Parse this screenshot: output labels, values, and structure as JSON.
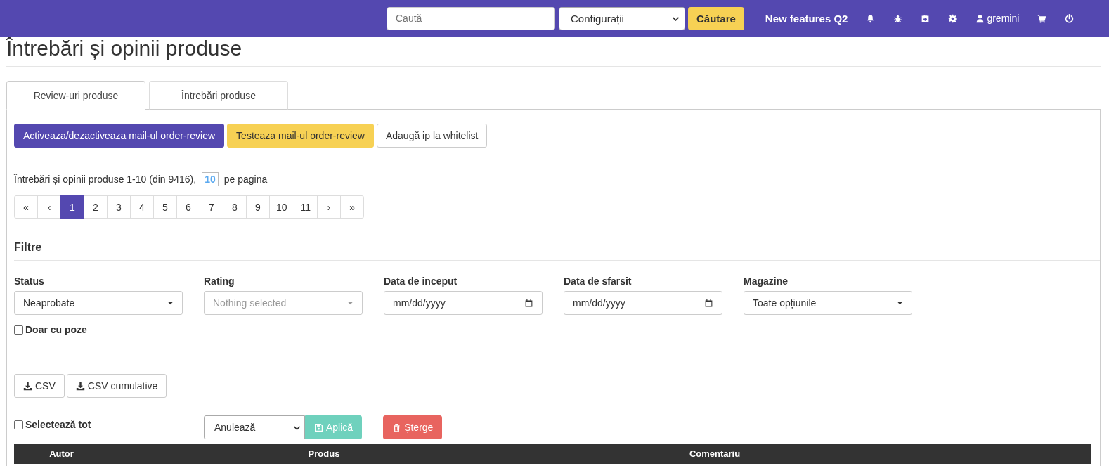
{
  "navbar": {
    "search": {
      "placeholder": "Caută"
    },
    "scope_select": {
      "value": "Configurații"
    },
    "search_button": "Căutare",
    "link": "New features Q2",
    "icons": [
      {
        "kind": "bell"
      },
      {
        "kind": "bug"
      },
      {
        "kind": "medkit"
      },
      {
        "kind": "gear"
      },
      {
        "kind": "user",
        "label": "gremini"
      },
      {
        "kind": "cart"
      },
      {
        "kind": "power"
      }
    ]
  },
  "page_title": "Întrebări și opinii produse",
  "tabs": [
    {
      "label": "Review-uri produse",
      "selected": true
    },
    {
      "label": "Întrebări produse",
      "selected": false
    }
  ],
  "action_buttons": [
    {
      "label": "Activeaza/dezactiveaza mail-ul order-review",
      "kind": "primary"
    },
    {
      "label": "Testeaza mail-ul order-review",
      "kind": "warning"
    },
    {
      "label": "Adaugă ip la whitelist",
      "kind": "default"
    }
  ],
  "summary": {
    "text": "Întrebări și opinii produse 1-10 (din 9416),",
    "per_page": "10",
    "per_page_label": "pe pagina"
  },
  "pagination": [
    {
      "label": "«",
      "selected": false
    },
    {
      "label": "‹",
      "selected": false
    },
    {
      "label": "1",
      "selected": true
    },
    {
      "label": "2",
      "selected": false
    },
    {
      "label": "3",
      "selected": false
    },
    {
      "label": "4",
      "selected": false
    },
    {
      "label": "5",
      "selected": false
    },
    {
      "label": "6",
      "selected": false
    },
    {
      "label": "7",
      "selected": false
    },
    {
      "label": "8",
      "selected": false
    },
    {
      "label": "9",
      "selected": false
    },
    {
      "label": "10",
      "selected": false
    },
    {
      "label": "11",
      "selected": false
    },
    {
      "label": "›",
      "selected": false
    },
    {
      "label": "»",
      "selected": false
    }
  ],
  "filters": {
    "title": "Filtre",
    "fields": [
      {
        "label": "Status",
        "kind": "select",
        "value": "Neaprobate"
      },
      {
        "label": "Rating",
        "kind": "select",
        "placeholder": "Nothing selected"
      },
      {
        "label": "Data de inceput",
        "kind": "date",
        "placeholder": "mm/dd/yyyy"
      },
      {
        "label": "Data de sfarsit",
        "kind": "date",
        "placeholder": "mm/dd/yyyy"
      },
      {
        "label": "Magazine",
        "kind": "select",
        "value": "Toate opțiunile"
      }
    ],
    "photos_only": {
      "label": "Doar cu poze",
      "checked": false
    }
  },
  "export_buttons": [
    "CSV",
    "CSV cumulative"
  ],
  "bulk": {
    "select_all": {
      "label": "Selectează tot",
      "checked": false
    },
    "action_select": {
      "value": "Anulează"
    },
    "apply_button": "Aplică",
    "delete_button": "Șterge"
  },
  "table": {
    "columns": [
      "Autor",
      "Produs",
      "Comentariu"
    ]
  }
}
